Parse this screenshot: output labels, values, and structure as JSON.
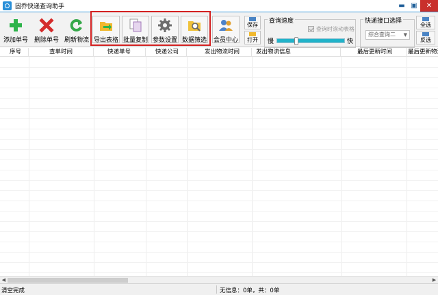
{
  "window": {
    "title": "固乔快递查询助手",
    "controls": {
      "minimize": "▬",
      "maximize": "▣",
      "close": "✕"
    }
  },
  "toolbar": {
    "buttons": [
      {
        "key": "add",
        "label": "添加单号",
        "icon": "plus-icon"
      },
      {
        "key": "delete",
        "label": "删除单号",
        "icon": "x-icon"
      },
      {
        "key": "refresh",
        "label": "刷新物流",
        "icon": "refresh-icon"
      },
      {
        "key": "export",
        "label": "导出表格",
        "icon": "folder-icon"
      },
      {
        "key": "copy",
        "label": "批量复制",
        "icon": "copy-icon"
      },
      {
        "key": "settings",
        "label": "参数设置",
        "icon": "gear-icon"
      },
      {
        "key": "filter",
        "label": "数据筛选",
        "icon": "search-folder-icon"
      },
      {
        "key": "member",
        "label": "会员中心",
        "icon": "users-icon"
      }
    ],
    "save_label": "保存",
    "open_label": "打开"
  },
  "speed": {
    "title": "查询速度",
    "auto_scroll_label": "查询时滚动表格",
    "slow_label": "慢",
    "fast_label": "快",
    "level_fraction": 0.27
  },
  "api": {
    "title": "快递接口选择",
    "selected": "综合查询二"
  },
  "side": {
    "select_all": "全选",
    "invert": "反选"
  },
  "table": {
    "columns": [
      "序号",
      "查单时间",
      "快递单号",
      "快递公司",
      "发出物流时间",
      "发出物流信息",
      "最后更新时间",
      "最后更新物流"
    ]
  },
  "status": {
    "left": "清空完成",
    "right": "无信息：0单，共：0单"
  },
  "colors": {
    "accent": "#2a8fd8",
    "highlight_border": "#d32020",
    "slider": "#21b3c9"
  }
}
